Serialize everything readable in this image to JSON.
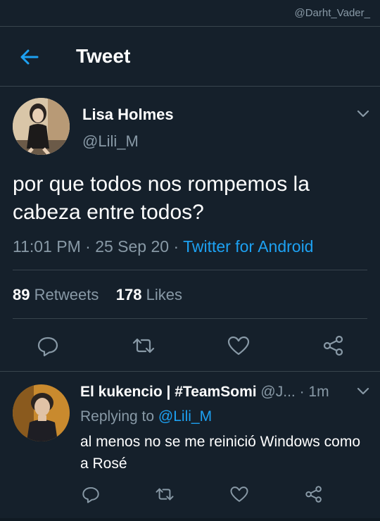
{
  "watermark": "@Darht_Vader_",
  "header": {
    "title": "Tweet"
  },
  "tweet": {
    "author_name": "Lisa Holmes",
    "author_handle": "@Lili_M",
    "text": "por que todos nos rompemos la cabeza entre todos?",
    "time": "11:01 PM",
    "date": "25 Sep 20",
    "source": "Twitter for Android",
    "retweets_count": "89",
    "retweets_label": "Retweets",
    "likes_count": "178",
    "likes_label": "Likes"
  },
  "reply": {
    "author_name": "El kukencio | #TeamSomi",
    "author_handle": "@J...",
    "time": "1m",
    "replying_prefix": "Replying to",
    "replying_to": "@Lili_M",
    "text": "al menos no se me reinició Windows como a Rosé"
  },
  "icons": {
    "back": "arrow-left-icon",
    "caret": "chevron-down-icon",
    "reply": "reply-bubble-icon",
    "retweet": "retweet-icon",
    "like": "heart-icon",
    "share": "share-icon"
  },
  "colors": {
    "background": "#15202b",
    "accent": "#1da1f2",
    "muted": "#8899a6",
    "divider": "#38444d"
  }
}
